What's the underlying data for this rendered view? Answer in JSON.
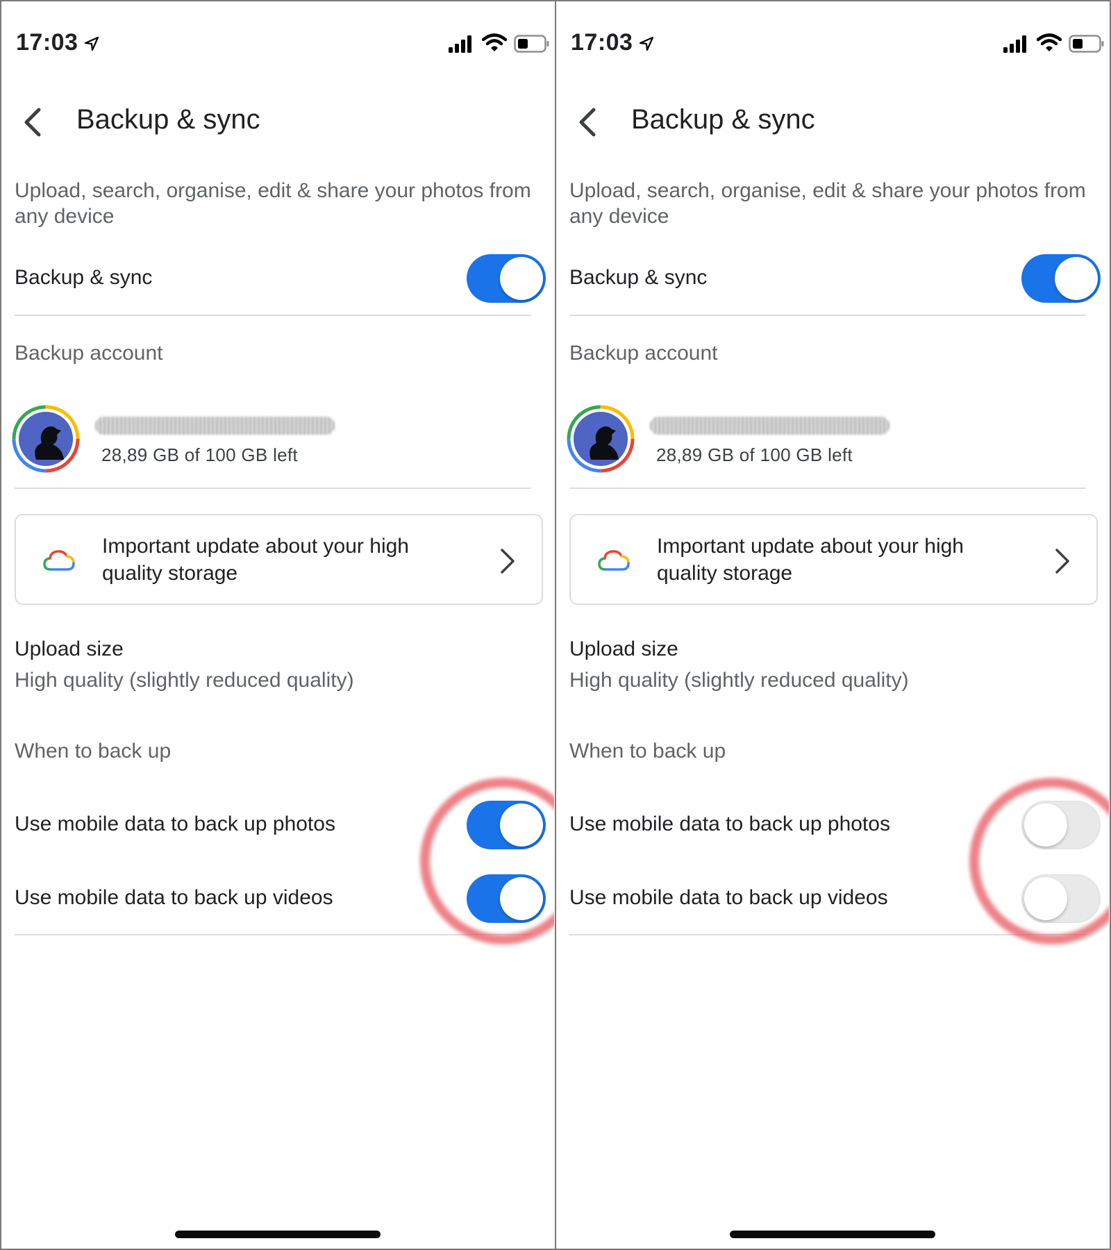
{
  "screens": [
    {
      "status": {
        "time": "17:03"
      },
      "header": {
        "title": "Backup & sync"
      },
      "description": "Upload, search, organise, edit & share your photos from any device",
      "backup_sync": {
        "label": "Backup & sync",
        "enabled": true
      },
      "account": {
        "section_label": "Backup account",
        "storage": "28,89 GB of 100 GB left"
      },
      "notice": {
        "text": "Important update about your high quality storage"
      },
      "upload_size": {
        "title": "Upload size",
        "value": "High quality (slightly reduced quality)"
      },
      "when_to_back_up": {
        "section_label": "When to back up",
        "photos": {
          "label": "Use mobile data to back up photos",
          "enabled": true
        },
        "videos": {
          "label": "Use mobile data to back up videos",
          "enabled": true
        }
      }
    },
    {
      "status": {
        "time": "17:03"
      },
      "header": {
        "title": "Backup & sync"
      },
      "description": "Upload, search, organise, edit & share your photos from any device",
      "backup_sync": {
        "label": "Backup & sync",
        "enabled": true
      },
      "account": {
        "section_label": "Backup account",
        "storage": "28,89 GB of 100 GB left"
      },
      "notice": {
        "text": "Important update about your high quality storage"
      },
      "upload_size": {
        "title": "Upload size",
        "value": "High quality (slightly reduced quality)"
      },
      "when_to_back_up": {
        "section_label": "When to back up",
        "photos": {
          "label": "Use mobile data to back up photos",
          "enabled": false
        },
        "videos": {
          "label": "Use mobile data to back up videos",
          "enabled": false
        }
      }
    }
  ],
  "colors": {
    "toggle_on": "#1a73e8",
    "toggle_off": "#e9e9ea",
    "highlight_ring": "#e85a62",
    "primary_text": "#202124",
    "secondary_text": "#5f6368"
  },
  "icons": [
    "location-arrow-icon",
    "signal-bars-icon",
    "wifi-icon",
    "battery-icon",
    "back-arrow-icon",
    "google-cloud-icon",
    "chevron-right-icon"
  ]
}
